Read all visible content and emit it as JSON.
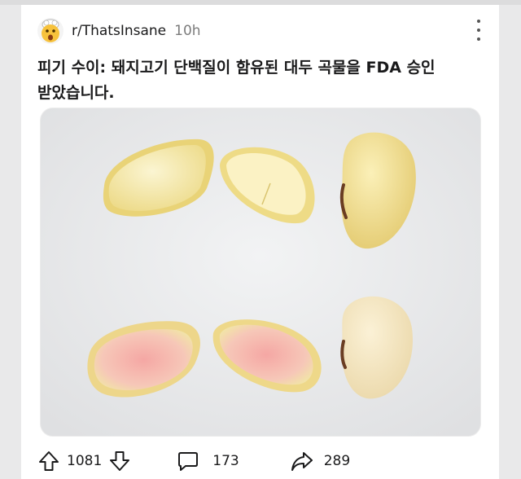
{
  "post": {
    "subreddit": "r/ThatsInsane",
    "time": "10h",
    "title_line1": "피기 수이: 돼지고기 단백질이 함유된 대두 곡물을 FDA 승인",
    "title_line2": "받았습니다."
  },
  "actions": {
    "upvotes": "1081",
    "comments": "173",
    "shares": "289"
  },
  "icons": {
    "avatar": "shocked-face-icon",
    "more": "more-vertical-icon",
    "upvote": "upvote-arrow-icon",
    "downvote": "downvote-arrow-icon",
    "comment": "comment-bubble-icon",
    "share": "share-arrow-icon"
  },
  "colors": {
    "bean_yellow": "#f1e59c",
    "bean_pink": "#f4b0a8",
    "background": "#e9e9ea"
  }
}
